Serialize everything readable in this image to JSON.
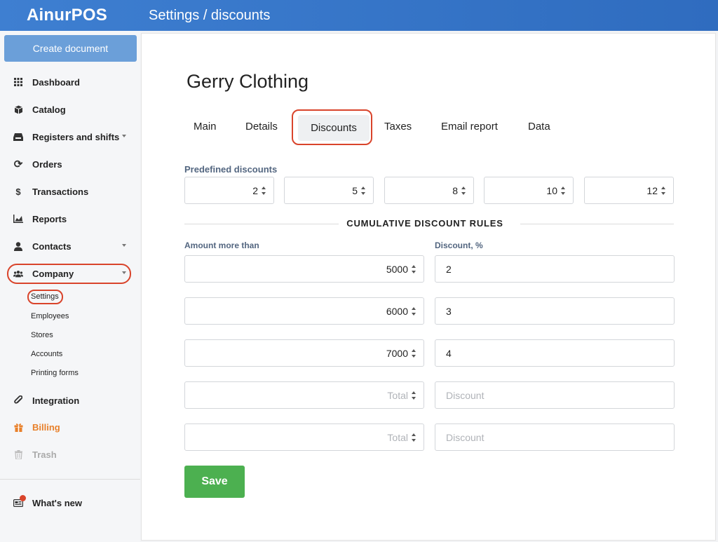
{
  "header": {
    "logo": "AinurPOS",
    "title": "Settings / discounts"
  },
  "sidebar": {
    "create_label": "Create document",
    "items": [
      {
        "label": "Dashboard",
        "icon": "grid-icon"
      },
      {
        "label": "Catalog",
        "icon": "box-icon"
      },
      {
        "label": "Registers and shifts",
        "icon": "register-icon"
      },
      {
        "label": "Orders",
        "icon": "refresh-icon"
      },
      {
        "label": "Transactions",
        "icon": "dollar-icon"
      },
      {
        "label": "Reports",
        "icon": "chart-icon"
      },
      {
        "label": "Contacts",
        "icon": "user-icon"
      },
      {
        "label": "Company",
        "icon": "users-icon"
      },
      {
        "label": "Integration",
        "icon": "paperclip-icon"
      },
      {
        "label": "Billing",
        "icon": "gift-icon"
      },
      {
        "label": "Trash",
        "icon": "trash-icon"
      }
    ],
    "company_sub": [
      "Settings",
      "Employees",
      "Stores",
      "Accounts",
      "Printing forms"
    ],
    "whats_new": "What's new"
  },
  "main": {
    "company_name": "Gerry Clothing",
    "tabs": [
      "Main",
      "Details",
      "Discounts",
      "Taxes",
      "Email report",
      "Data"
    ],
    "active_tab": "Discounts",
    "predefined_label": "Predefined discounts",
    "predefined_values": [
      "2",
      "5",
      "8",
      "10",
      "12"
    ],
    "section_title": "CUMULATIVE DISCOUNT RULES",
    "amount_label": "Amount more than",
    "discount_label": "Discount, %",
    "rules": [
      {
        "amount": "5000",
        "discount": "2"
      },
      {
        "amount": "6000",
        "discount": "3"
      },
      {
        "amount": "7000",
        "discount": "4"
      }
    ],
    "amount_placeholder": "Total",
    "discount_placeholder": "Discount",
    "save_label": "Save"
  },
  "colors": {
    "header": "#3e7fd1",
    "accent": "#4cb050",
    "highlight": "#d9442b",
    "billing": "#e8802a"
  }
}
